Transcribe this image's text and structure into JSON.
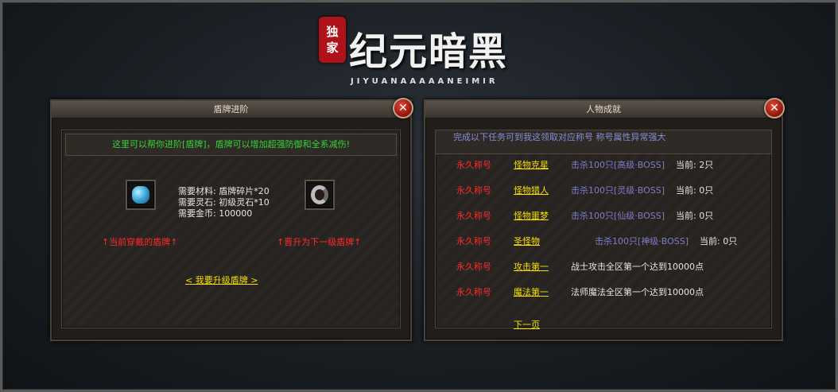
{
  "logo": {
    "seal_top": "独",
    "seal_bottom": "家",
    "title": "纪元暗黑",
    "subtitle": "JIYUANAAAAANEIMIR"
  },
  "shield_panel": {
    "title": "盾牌进阶",
    "close_label": "✕",
    "notice": "这里可以帮你进阶[盾牌]，盾牌可以增加超强防御和全系减伤!",
    "requirements": [
      "需要材料: 盾牌碎片*20",
      "需要灵石: 初级灵石*10",
      "需要金币: 100000"
    ],
    "current_caption": "↑当前穿戴的盾牌↑",
    "next_caption": "↑晋升为下一级盾牌↑",
    "upgrade_link": "<  我要升级盾牌  >"
  },
  "achievement_panel": {
    "title": "人物成就",
    "close_label": "✕",
    "intro": "完成以下任务可到我这领取对应称号 称号属性异常强大",
    "rows": [
      {
        "type": "永久称号",
        "name": "怪物克星",
        "task": "击杀100只[高级·BOSS]",
        "progress": "当前: 2只"
      },
      {
        "type": "永久称号",
        "name": "怪物猎人",
        "task": "击杀100只[灵级·BOSS]",
        "progress": "当前: 0只"
      },
      {
        "type": "永久称号",
        "name": "怪物噩梦",
        "task": "击杀100只[仙级·BOSS]",
        "progress": "当前: 0只"
      },
      {
        "type": "永久称号",
        "name": "圣怪物",
        "task": "击杀100只[神级·BOSS]",
        "progress": "当前: 0只"
      },
      {
        "type": "永久称号",
        "name": "攻击第一",
        "task": "战士攻击全区第一个达到10000点",
        "progress": ""
      },
      {
        "type": "永久称号",
        "name": "魔法第一",
        "task": "法师魔法全区第一个达到10000点",
        "progress": ""
      }
    ],
    "next_page": "下一页"
  }
}
